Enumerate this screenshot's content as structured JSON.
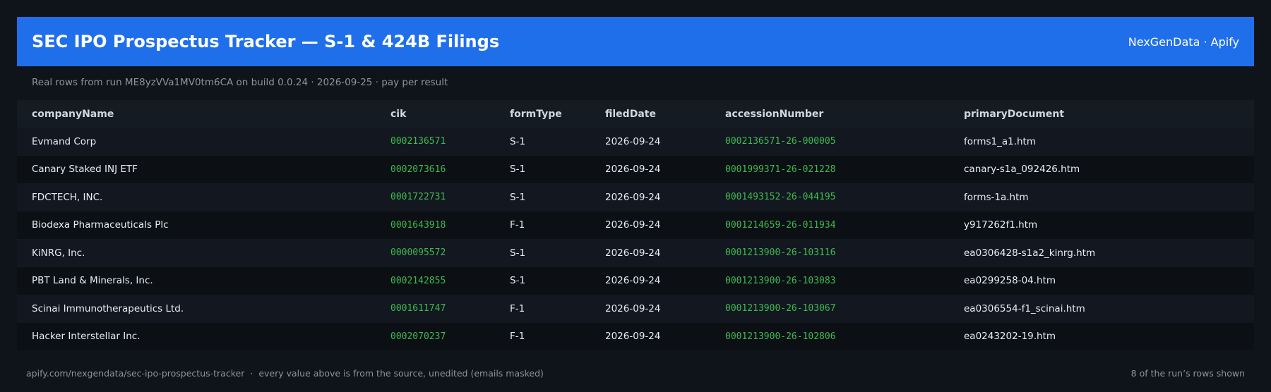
{
  "header": {
    "title": "SEC IPO Prospectus Tracker — S-1 & 424B Filings",
    "brand": "NexGenData · Apify"
  },
  "subtitle": "Real rows from run ME8yzVVa1MV0tm6CA on build 0.0.24 · 2026-09-25 · pay per result",
  "table": {
    "columns": [
      "companyName",
      "cik",
      "formType",
      "filedDate",
      "accessionNumber",
      "primaryDocument"
    ],
    "rows": [
      [
        "Evmand Corp",
        "0002136571",
        "S-1",
        "2026-09-24",
        "0002136571-26-000005",
        "forms1_a1.htm"
      ],
      [
        "Canary Staked INJ ETF",
        "0002073616",
        "S-1",
        "2026-09-24",
        "0001999371-26-021228",
        "canary-s1a_092426.htm"
      ],
      [
        "FDCTECH, INC.",
        "0001722731",
        "S-1",
        "2026-09-24",
        "0001493152-26-044195",
        "forms-1a.htm"
      ],
      [
        "Biodexa Pharmaceuticals Plc",
        "0001643918",
        "F-1",
        "2026-09-24",
        "0001214659-26-011934",
        "y917262f1.htm"
      ],
      [
        "KiNRG, Inc.",
        "0000095572",
        "S-1",
        "2026-09-24",
        "0001213900-26-103116",
        "ea0306428-s1a2_kinrg.htm"
      ],
      [
        "PBT Land & Minerals, Inc.",
        "0002142855",
        "S-1",
        "2026-09-24",
        "0001213900-26-103083",
        "ea0299258-04.htm"
      ],
      [
        "Scinai Immunotherapeutics Ltd.",
        "0001611747",
        "F-1",
        "2026-09-24",
        "0001213900-26-103067",
        "ea0306554-f1_scinai.htm"
      ],
      [
        "Hacker Interstellar Inc.",
        "0002070237",
        "F-1",
        "2026-09-24",
        "0001213900-26-102806",
        "ea0243202-19.htm"
      ]
    ]
  },
  "footer": {
    "url": "apify.com/nexgendata/sec-ipo-prospectus-tracker",
    "separator": "·",
    "note": "every value above is from the source, unedited (emails masked)",
    "count": "8 of the run’s rows shown"
  },
  "colors": {
    "header_bg": "#1f6feb",
    "page_bg": "#0f141b",
    "mono_accent": "#3fb950",
    "muted_text": "#8b949e"
  }
}
